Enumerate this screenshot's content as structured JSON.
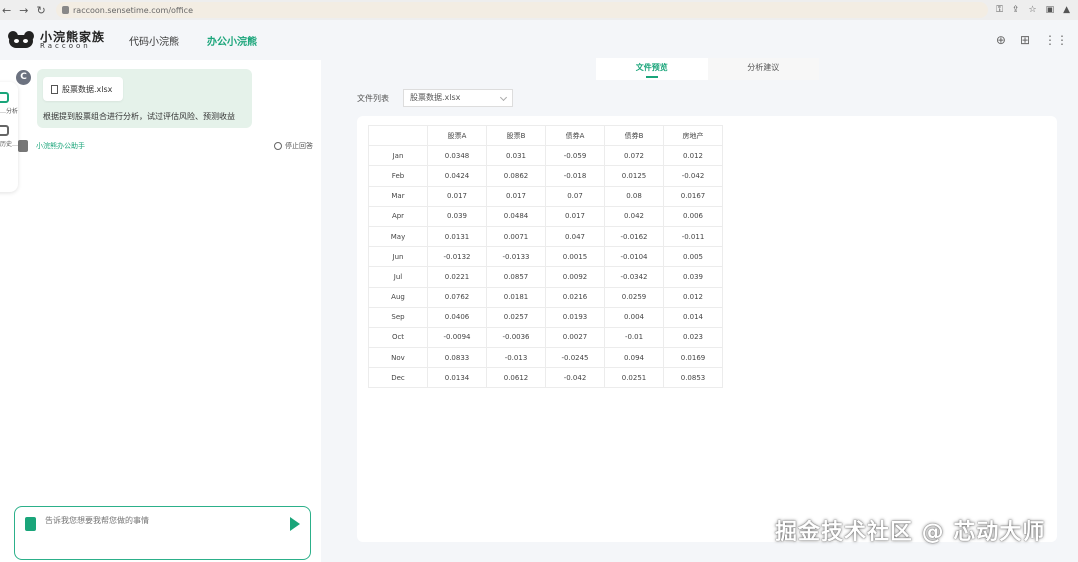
{
  "browser": {
    "url": "raccoon.sensetime.com/office"
  },
  "app": {
    "logo_cn": "小浣熊家族",
    "logo_en": "Raccoon",
    "nav": [
      {
        "label": "代码小浣熊",
        "active": false
      },
      {
        "label": "办公小浣熊",
        "active": true
      }
    ]
  },
  "sidebar_tabs": [
    "…分析",
    "历史…"
  ],
  "chat": {
    "user_avatar": "C",
    "file_name": "股票数据.xlsx",
    "message": "根据提到股票组合进行分析，试过评估风险、预测收益",
    "bot_name": "小浣熊办公助手",
    "stop_label": "停止回答",
    "input_placeholder": "告诉我您想要我帮您做的事情"
  },
  "preview": {
    "tabs": [
      {
        "label": "文件预览",
        "active": true
      },
      {
        "label": "分析建议",
        "active": false
      }
    ],
    "file_list_label": "文件列表",
    "selected_file": "股票数据.xlsx",
    "table": {
      "headers": [
        "",
        "股票A",
        "股票B",
        "债券A",
        "债券B",
        "房地产"
      ],
      "rows": [
        [
          "Jan",
          "0.0348",
          "0.031",
          "-0.059",
          "0.072",
          "0.012"
        ],
        [
          "Feb",
          "0.0424",
          "0.0862",
          "-0.018",
          "0.0125",
          "-0.042"
        ],
        [
          "Mar",
          "0.017",
          "0.017",
          "0.07",
          "0.08",
          "0.0167"
        ],
        [
          "Apr",
          "0.039",
          "0.0484",
          "0.017",
          "0.042",
          "0.006"
        ],
        [
          "May",
          "0.0131",
          "0.0071",
          "0.047",
          "-0.0162",
          "-0.011"
        ],
        [
          "Jun",
          "-0.0132",
          "-0.0133",
          "0.0015",
          "-0.0104",
          "0.005"
        ],
        [
          "Jul",
          "0.0221",
          "0.0857",
          "0.0092",
          "-0.0342",
          "0.039"
        ],
        [
          "Aug",
          "0.0762",
          "0.0181",
          "0.0216",
          "0.0259",
          "0.012"
        ],
        [
          "Sep",
          "0.0406",
          "0.0257",
          "0.0193",
          "0.004",
          "0.014"
        ],
        [
          "Oct",
          "-0.0094",
          "-0.0036",
          "0.0027",
          "-0.01",
          "0.023"
        ],
        [
          "Nov",
          "0.0833",
          "-0.013",
          "-0.0245",
          "0.094",
          "0.0169"
        ],
        [
          "Dec",
          "0.0134",
          "0.0612",
          "-0.042",
          "0.0251",
          "0.0853"
        ]
      ]
    }
  },
  "watermark": "掘金技术社区 @ 芯动大师"
}
